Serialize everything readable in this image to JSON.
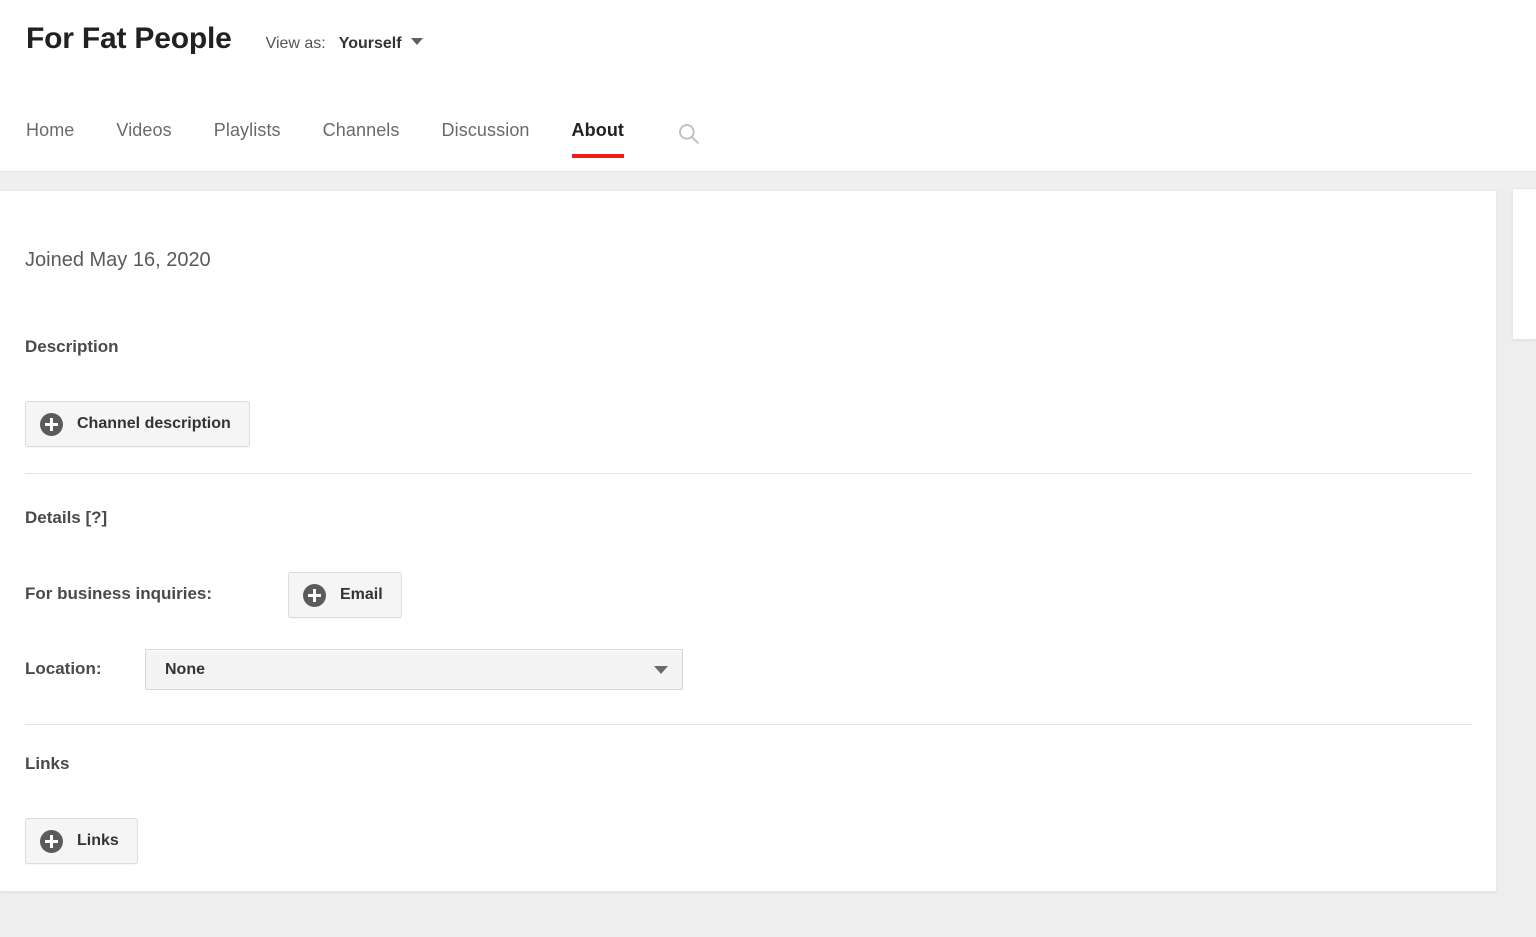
{
  "header": {
    "channel_title": "For Fat People",
    "view_as_label": "View as:",
    "view_as_value": "Yourself",
    "caret_icon": "chevron-down-icon"
  },
  "nav": {
    "tabs": [
      {
        "label": "Home",
        "active": false
      },
      {
        "label": "Videos",
        "active": false
      },
      {
        "label": "Playlists",
        "active": false
      },
      {
        "label": "Channels",
        "active": false
      },
      {
        "label": "Discussion",
        "active": false
      },
      {
        "label": "About",
        "active": true
      }
    ],
    "search_icon": "search-icon",
    "active_underline_color": "#ee1c15"
  },
  "about": {
    "joined": "Joined May 16, 2020",
    "description_heading": "Description",
    "channel_description_button": "Channel description",
    "details_heading": "Details [?]",
    "business_label": "For business inquiries:",
    "email_button": "Email",
    "location_label": "Location:",
    "location_value": "None",
    "location_options": [
      "None"
    ],
    "links_heading": "Links",
    "links_button": "Links",
    "plus_icon": "plus-circle-icon",
    "select_caret_icon": "chevron-down-icon"
  }
}
